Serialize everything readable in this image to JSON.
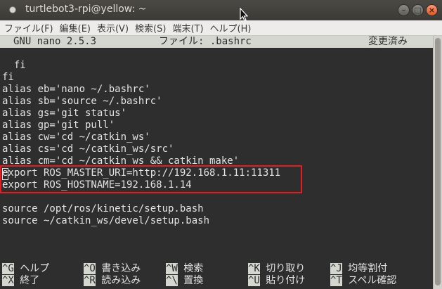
{
  "window": {
    "title": "turtlebot3-rpi@yellow: ~"
  },
  "menubar": {
    "items": [
      "ファイル(F)",
      "編集(E)",
      "表示(V)",
      "検索(S)",
      "端末(T)",
      "ヘルプ(H)"
    ]
  },
  "nano": {
    "version": "GNU nano 2.5.3",
    "file_label": "ファイル: .bashrc",
    "status": "変更済み"
  },
  "editor": {
    "lines": [
      "",
      "  fi",
      "fi",
      "alias eb='nano ~/.bashrc'",
      "alias sb='source ~/.bashrc'",
      "alias gs='git status'",
      "alias gp='git pull'",
      "alias cw='cd ~/catkin_ws'",
      "alias cs='cd ~/catkin_ws/src'",
      "alias cm='cd ~/catkin_ws && catkin_make'",
      "export ROS_MASTER_URI=http://192.168.1.11:11311",
      "export ROS_HOSTNAME=192.168.1.14",
      "",
      "source /opt/ros/kinetic/setup.bash",
      "source ~/catkin_ws/devel/setup.bash"
    ]
  },
  "shortcuts": [
    {
      "key": "^G",
      "label": "ヘルプ"
    },
    {
      "key": "^O",
      "label": "書き込み"
    },
    {
      "key": "^W",
      "label": "検索"
    },
    {
      "key": "^K",
      "label": "切り取り"
    },
    {
      "key": "^J",
      "label": "均等割付"
    },
    {
      "key": "^X",
      "label": "終了"
    },
    {
      "key": "^R",
      "label": "読み込み"
    },
    {
      "key": "^\\",
      "label": "置換"
    },
    {
      "key": "^U",
      "label": "貼り付け"
    },
    {
      "key": "^T",
      "label": "スペル確認"
    }
  ],
  "colors": {
    "terminal_bg": "#2e2e2e",
    "terminal_fg": "#e3e3e3",
    "highlight_border": "#e02020",
    "titlebar_bg": "#3c3b37"
  }
}
